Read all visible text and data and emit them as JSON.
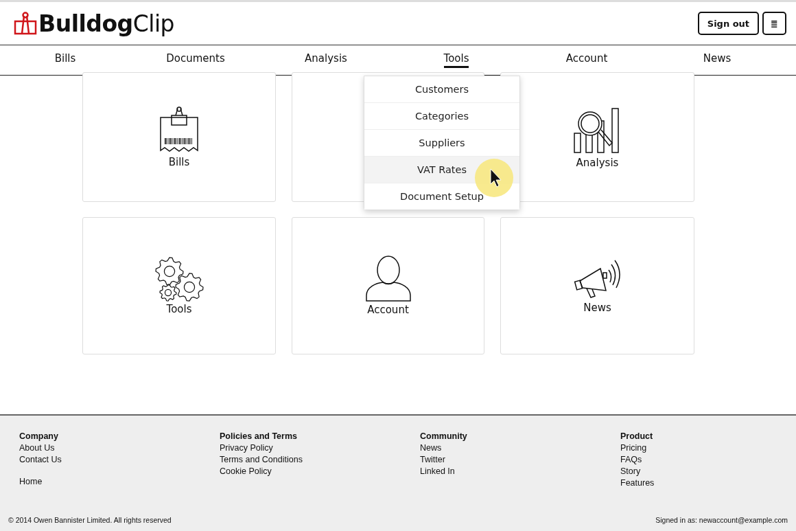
{
  "header": {
    "logo": "**Bulldog**Clip",
    "buttons": [
      {
        "kind": "text",
        "label": "Sign out"
      },
      {
        "kind": "menu",
        "label": "≣"
      }
    ]
  },
  "nav": [
    {
      "label": "Bills",
      "selected": false
    },
    {
      "label": "Documents",
      "selected": false
    },
    {
      "label": "Analysis",
      "selected": false
    },
    {
      "label": "Tools",
      "selected": true
    },
    {
      "label": "Account",
      "selected": false
    },
    {
      "label": "News",
      "selected": false
    }
  ],
  "dropdown": [
    {
      "label": "Customers",
      "selected": false
    },
    {
      "label": "Categories",
      "selected": false
    },
    {
      "label": "Suppliers",
      "selected": false
    },
    {
      "label": "VAT Rates",
      "selected": true
    },
    {
      "label": "Document Setup",
      "selected": false
    }
  ],
  "cards": [
    {
      "kind": "bills",
      "label": "Bills"
    },
    {
      "kind": "covered"
    },
    {
      "kind": "analysis",
      "label": "Analysis"
    },
    {
      "kind": "tools",
      "label": "Tools"
    },
    {
      "kind": "account",
      "label": "Account"
    },
    {
      "kind": "news",
      "label": "News"
    }
  ],
  "footer": {
    "columns": [
      {
        "title": "Company",
        "groups": [
          [
            "About Us",
            "Contact Us"
          ],
          [
            "Home"
          ]
        ]
      },
      {
        "title": "Policies and Terms",
        "groups": [
          [
            "Privacy Policy",
            "Terms and Conditions",
            "Cookie Policy"
          ]
        ]
      },
      {
        "title": "Community",
        "groups": [
          [
            "News",
            "Twitter",
            "Linked In"
          ]
        ]
      },
      {
        "title": "Product",
        "groups": [
          [
            "Pricing",
            "FAQs",
            "Story",
            "Features"
          ]
        ]
      }
    ],
    "copyright": "© 2014 Owen Bannister Limited. All rights reserved",
    "signed_in": "Signed in as: newaccount@example.com"
  }
}
